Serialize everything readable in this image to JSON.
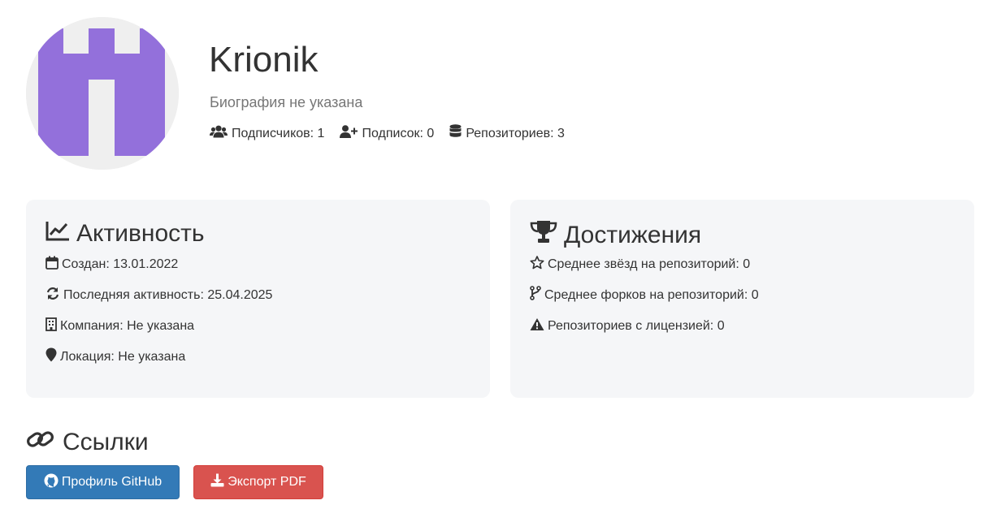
{
  "profile": {
    "name": "Krionik",
    "bio": "Биография не указана",
    "avatar_color": "#9370db",
    "stats": {
      "followers": "Подписчиков: 1",
      "following": "Подписок: 0",
      "repos": "Репозиториев: 3"
    }
  },
  "activity": {
    "title": "Активность",
    "created": "Создан: 13.01.2022",
    "last_active": "Последняя активность: 25.04.2025",
    "company": "Компания: Не указана",
    "location": "Локация: Не указана"
  },
  "achievements": {
    "title": "Достижения",
    "avg_stars": "Среднее звёзд на репозиторий: 0",
    "avg_forks": "Среднее форков на репозиторий: 0",
    "licensed": "Репозиториев с лицензией: 0"
  },
  "links": {
    "title": "Ссылки",
    "github_button": "Профиль GitHub",
    "pdf_button": "Экспорт PDF"
  },
  "colors": {
    "primary": "#337ab7",
    "danger": "#d9534f",
    "card_bg": "#f5f6f8"
  }
}
